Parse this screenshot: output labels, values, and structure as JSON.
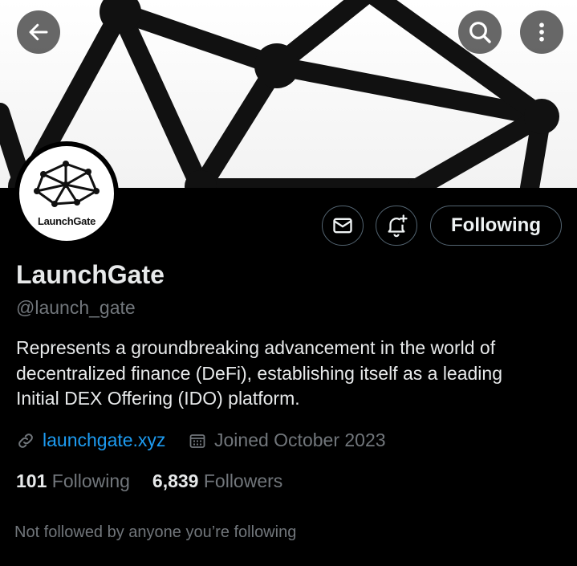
{
  "header": {
    "back_icon": "arrow-left-icon",
    "search_icon": "search-icon",
    "more_icon": "more-vertical-icon"
  },
  "avatar": {
    "logo_text": "LaunchGate"
  },
  "actions": {
    "message_icon": "envelope-icon",
    "notify_icon": "bell-plus-icon",
    "follow_label": "Following"
  },
  "profile": {
    "name": "LaunchGate",
    "handle": "@launch_gate",
    "bio_lines": [
      "Represents a groundbreaking advancement in the world of",
      "decentralized finance (DeFi), establishing itself as a leading",
      "Initial DEX Offering (IDO) platform."
    ],
    "website": "launchgate.xyz",
    "joined": "Joined October 2023",
    "following_count": "101",
    "following_label": "Following",
    "followers_count": "6,839",
    "followers_label": "Followers",
    "followed_by_note": "Not followed by anyone you’re following"
  },
  "colors": {
    "link": "#1d9bf0",
    "muted": "#71767b",
    "text": "#e7e9ea"
  }
}
